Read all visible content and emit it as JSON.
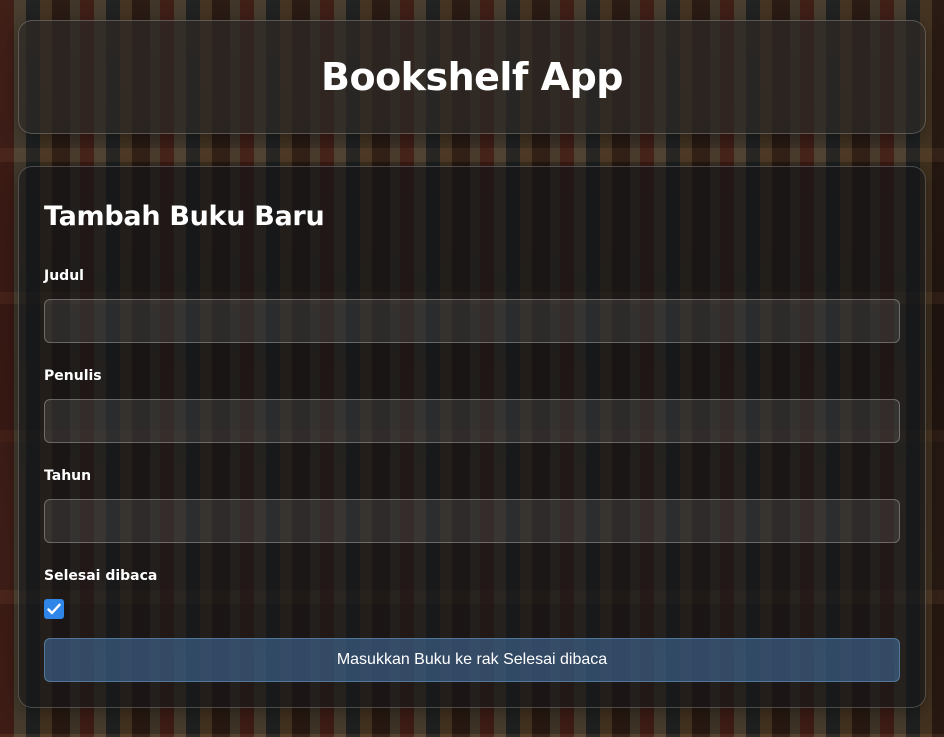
{
  "header": {
    "title": "Bookshelf App"
  },
  "form": {
    "title": "Tambah Buku Baru",
    "fields": [
      {
        "label": "Judul",
        "value": "",
        "placeholder": ""
      },
      {
        "label": "Penulis",
        "value": "",
        "placeholder": ""
      },
      {
        "label": "Tahun",
        "value": "",
        "placeholder": ""
      }
    ],
    "checkbox": {
      "label": "Selesai dibaca",
      "checked": true
    },
    "submit_label": "Masukkan Buku ke rak Selesai dibaca"
  },
  "colors": {
    "accent": "#2f86e8",
    "button_bg": "#46739f"
  }
}
